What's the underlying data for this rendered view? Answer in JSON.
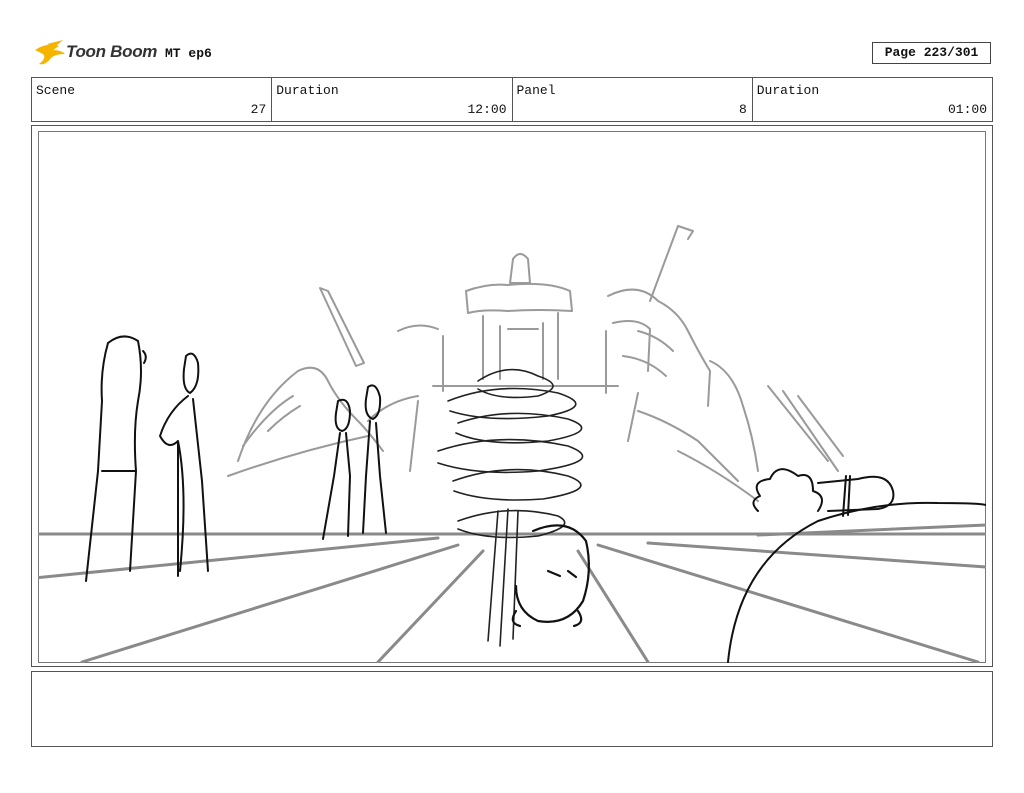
{
  "header": {
    "brand": "Toon Boom",
    "project": "MT ep6",
    "page": "Page 223/301"
  },
  "info": [
    {
      "label": "Scene",
      "value": "27"
    },
    {
      "label": "Duration",
      "value": "12:00"
    },
    {
      "label": "Panel",
      "value": "8"
    },
    {
      "label": "Duration",
      "value": "01:00"
    }
  ],
  "colors": {
    "logo_accent": "#f5b400",
    "border": "#555555",
    "sketch_dark": "#111111",
    "sketch_grey": "#8a8a8a"
  },
  "icons": [
    "toon-boom-logo-icon"
  ]
}
